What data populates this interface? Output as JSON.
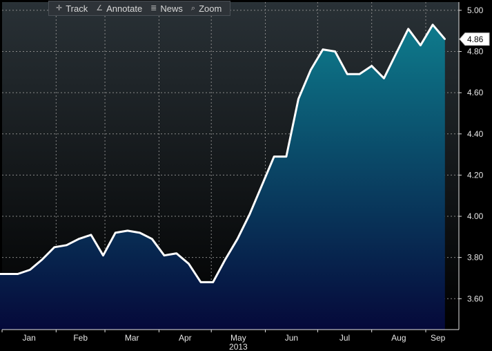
{
  "toolbar": {
    "track_label": "Track",
    "annotate_label": "Annotate",
    "news_label": "News",
    "zoom_label": "Zoom"
  },
  "colors": {
    "line": "#ffffff",
    "area_top": "#0e7b8c",
    "area_bottom": "#05093a",
    "bg_top": "#293136",
    "bg_bottom": "#000000",
    "grid": "#8a8a8a",
    "axis_text": "#e6e6e6"
  },
  "chart_data": {
    "type": "area",
    "title": "",
    "xlabel": "",
    "ylabel": "",
    "year_label": "2013",
    "x_tick_labels": [
      "Jan",
      "Feb",
      "Mar",
      "Apr",
      "May",
      "Jun",
      "Jul",
      "Aug",
      "Sep"
    ],
    "y_ticks": [
      "5.00",
      "4.80",
      "4.60",
      "4.40",
      "4.20",
      "4.00",
      "3.80",
      "3.60"
    ],
    "ylim": [
      3.45,
      5.04
    ],
    "grid": true,
    "last_value_label": "4.86",
    "series": [
      {
        "x": [
          "2013-01-03",
          "2013-01-10",
          "2013-01-17",
          "2013-01-24",
          "2013-01-31",
          "2013-02-07",
          "2013-02-14",
          "2013-02-21",
          "2013-02-28",
          "2013-03-07",
          "2013-03-14",
          "2013-03-21",
          "2013-03-28",
          "2013-04-04",
          "2013-04-11",
          "2013-04-18",
          "2013-04-25",
          "2013-05-02",
          "2013-05-09",
          "2013-05-16",
          "2013-05-23",
          "2013-05-30",
          "2013-06-06",
          "2013-06-13",
          "2013-06-20",
          "2013-06-27",
          "2013-07-04",
          "2013-07-11",
          "2013-07-18",
          "2013-07-25",
          "2013-08-01",
          "2013-08-08",
          "2013-08-15",
          "2013-08-22",
          "2013-08-29",
          "2013-09-05",
          "2013-09-12"
        ],
        "values": [
          3.72,
          3.72,
          3.74,
          3.79,
          3.85,
          3.86,
          3.89,
          3.91,
          3.81,
          3.92,
          3.93,
          3.92,
          3.89,
          3.81,
          3.82,
          3.77,
          3.68,
          3.68,
          3.79,
          3.89,
          4.01,
          4.15,
          4.29,
          4.29,
          4.57,
          4.71,
          4.81,
          4.8,
          4.69,
          4.69,
          4.73,
          4.67,
          4.79,
          4.91,
          4.83,
          4.93,
          4.86
        ]
      }
    ]
  }
}
